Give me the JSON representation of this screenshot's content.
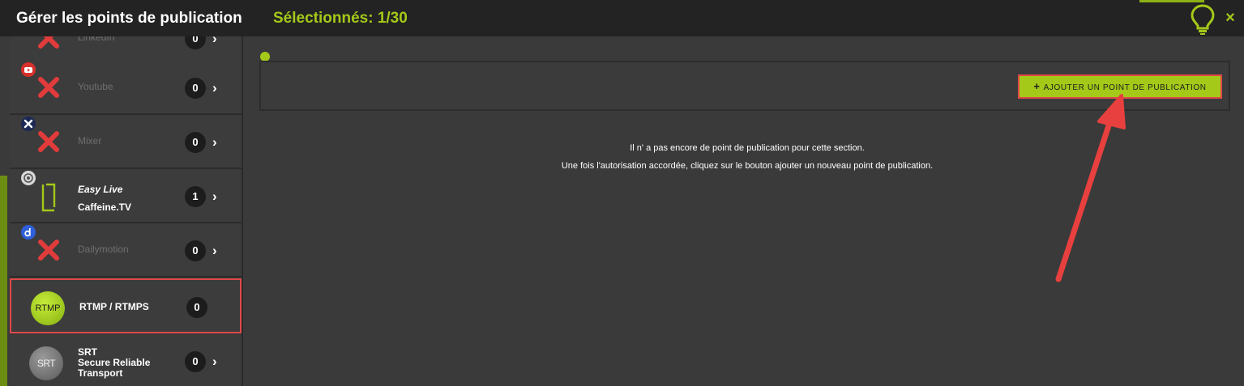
{
  "header": {
    "title": "Gérer les points de publication",
    "selected": "Sélectionnés: 1/30",
    "close_label": "×"
  },
  "sidebar": {
    "items": [
      {
        "name": "LinkedIn",
        "count": "0",
        "chevron": "›",
        "icon": "linkedin-icon",
        "status": "not-authorized"
      },
      {
        "name": "Youtube",
        "count": "0",
        "chevron": "›",
        "icon": "youtube-icon",
        "status": "not-authorized"
      },
      {
        "name": "Mixer",
        "count": "0",
        "chevron": "›",
        "icon": "mixer-icon",
        "status": "not-authorized"
      },
      {
        "name": "Easy Live",
        "sub": "Caffeine.TV",
        "count": "1",
        "chevron": "›",
        "icon": "caffeine-icon",
        "status": "authorized"
      },
      {
        "name": "Dailymotion",
        "count": "0",
        "chevron": "›",
        "icon": "dailymotion-icon",
        "status": "not-authorized"
      },
      {
        "name": "RTMP / RTMPS",
        "count": "0",
        "badge": "RTMP",
        "icon": "rtmp-icon",
        "status": "selected"
      },
      {
        "name": "SRT",
        "sub1": "Secure Reliable",
        "sub2": "Transport",
        "count": "0",
        "chevron": "›",
        "badge": "SRT",
        "icon": "srt-icon"
      }
    ]
  },
  "main": {
    "add_button": "AJOUTER UN POINT DE PUBLICATION",
    "add_plus": "+",
    "empty_line1": "Il n' a pas encore de point de publication pour cette section.",
    "empty_line2": "Une fois l'autorisation accordée, cliquez sur le bouton ajouter un nouveau point de publication."
  },
  "colors": {
    "accent": "#a4c919",
    "highlight": "#e04848",
    "background": "#3a3a3a",
    "header": "#232323"
  }
}
